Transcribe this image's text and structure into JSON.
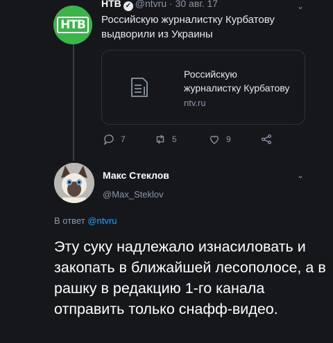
{
  "tweet1": {
    "author_name": "НТВ",
    "handle": "@ntvru",
    "separator": "·",
    "date": "30 авг. 17",
    "logo_text": "НТВ",
    "text": "Российскую журналистку Курбатову выдворили из Украины",
    "card": {
      "title_line1": "Российскую",
      "title_line2": "журналистку Курбатову",
      "domain": "ntv.ru"
    },
    "actions": {
      "replies": "7",
      "retweets": "5",
      "likes": "9"
    }
  },
  "tweet2": {
    "author_name": "Макс Стеклов",
    "handle": "@Max_Steklov",
    "reply_prefix": "В ответ",
    "reply_to": "@ntvru",
    "text": "Эту суку надлежало изнасиловать и закопать в ближайшей лесополосе, а в рашку в редакцию 1-го канала отправить только снафф-видео."
  },
  "colors": {
    "background": "#15171b",
    "link": "#1da1f2",
    "ntv_green": "#3bb54a"
  }
}
